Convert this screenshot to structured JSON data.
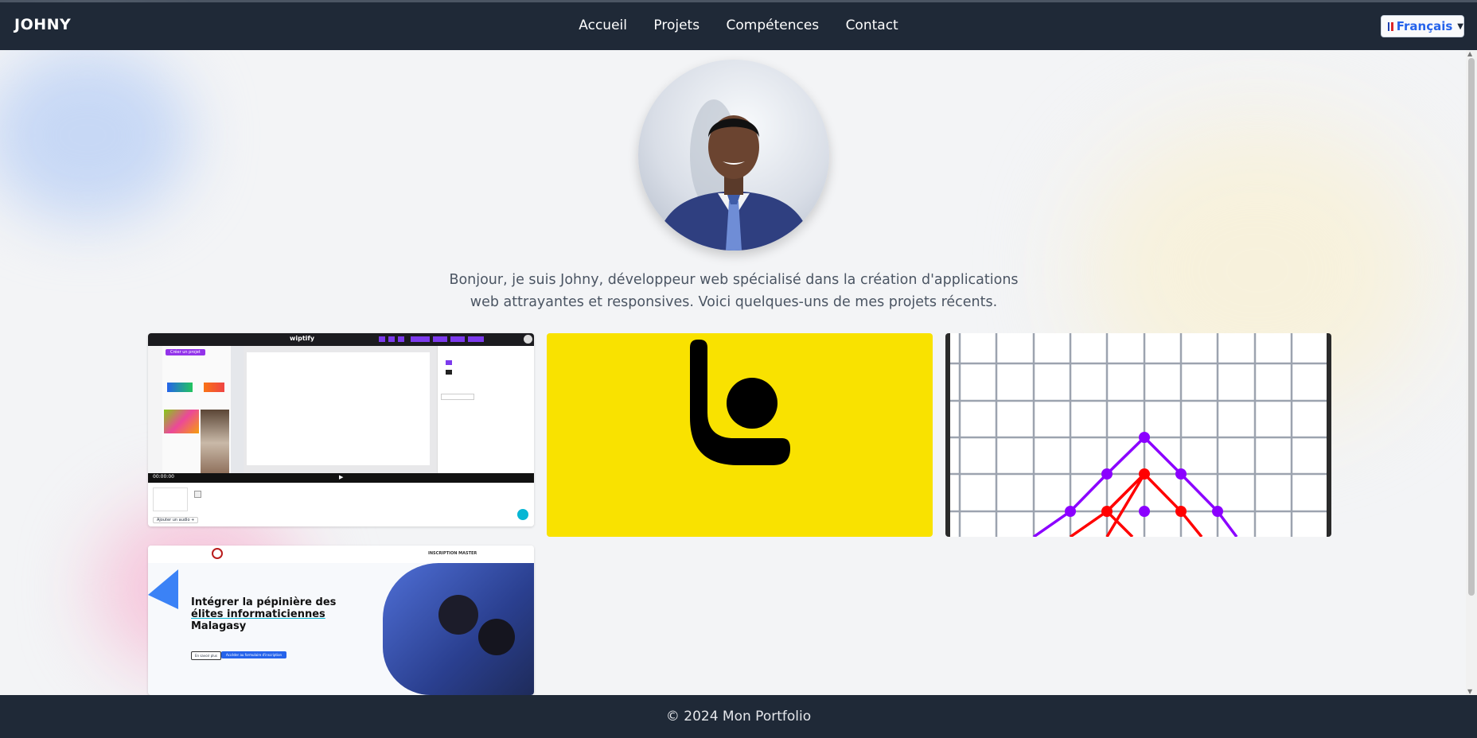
{
  "brand": "JOHNY",
  "nav": {
    "items": [
      "Accueil",
      "Projets",
      "Compétences",
      "Contact"
    ]
  },
  "language": {
    "selected": "Français"
  },
  "intro": {
    "line1": "Bonjour, je suis Johny, développeur web spécialisé dans la création d'applications",
    "line2": "web attrayantes et responsives. Voici quelques-uns de mes projets récents."
  },
  "projects": {
    "p1": {
      "app_name": "wiptify",
      "button": "Créer un projet",
      "timecode": "00:00:00",
      "add_audio": "Ajouter un audio +"
    },
    "p4": {
      "headline_1": "Intégrer la pépinière des",
      "headline_2": "élites informaticiennes",
      "headline_3": "Malagasy",
      "nav_label": "INSCRIPTION MASTER",
      "btn_more": "En savoir plus",
      "btn_register": "Accéder au formulaire d'inscription"
    }
  },
  "footer": {
    "text": "© 2024 Mon Portfolio"
  },
  "colors": {
    "header_bg": "#1f2937",
    "accent": "#2563eb",
    "logo_yellow": "#f9e200"
  }
}
